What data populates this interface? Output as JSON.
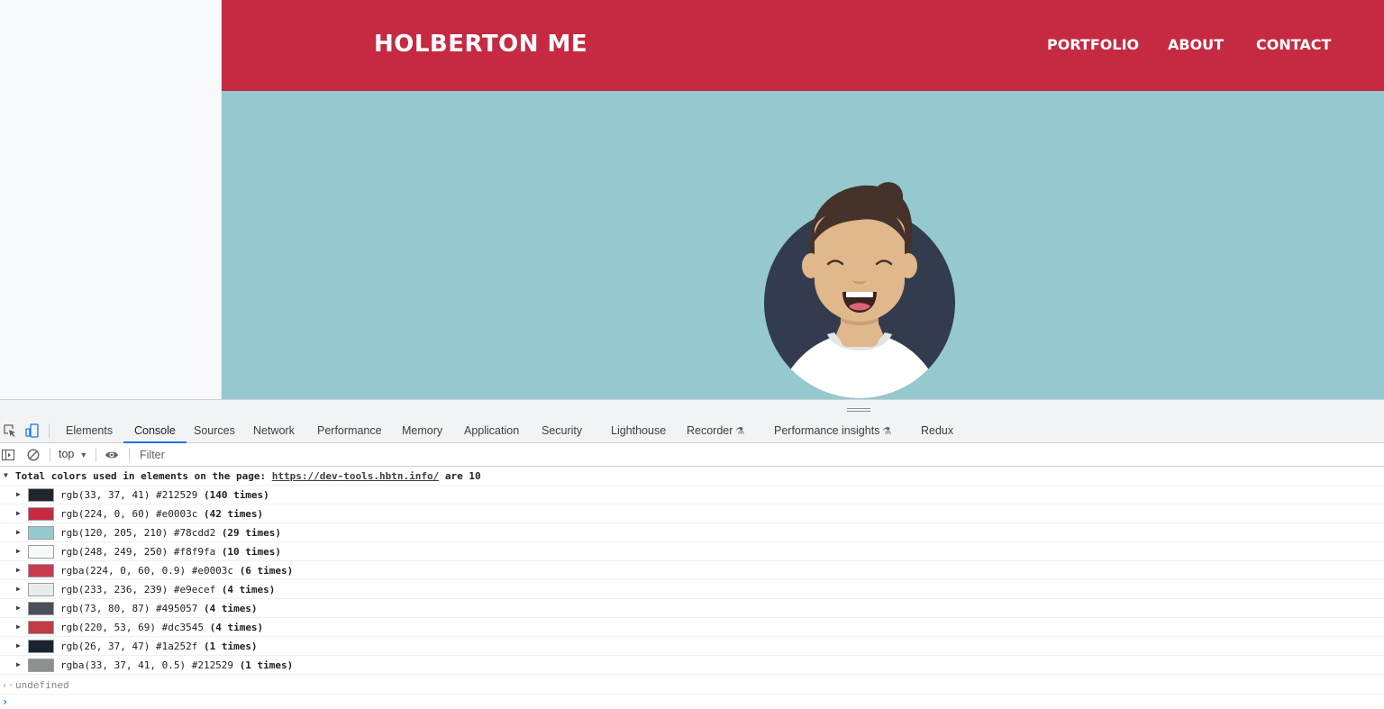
{
  "colors": {
    "site_header_bg": "#c52a42",
    "hero_bg": "#96c9cf",
    "avatar_circle": "#323c4e",
    "skin": "#e0b88c",
    "hair": "#45322b",
    "shirt": "#ffffff",
    "accent_blue": "#1a73e8"
  },
  "site": {
    "brand": "HOLBERTON ME",
    "nav": [
      "PORTFOLIO",
      "ABOUT",
      "CONTACT"
    ]
  },
  "devtools": {
    "tabs": [
      {
        "label": "Elements",
        "active": false
      },
      {
        "label": "Console",
        "active": true
      },
      {
        "label": "Sources",
        "active": false
      },
      {
        "label": "Network",
        "active": false
      },
      {
        "label": "Performance",
        "active": false
      },
      {
        "label": "Memory",
        "active": false
      },
      {
        "label": "Application",
        "active": false
      },
      {
        "label": "Security",
        "active": false
      },
      {
        "label": "Lighthouse",
        "active": false
      },
      {
        "label": "Recorder",
        "active": false,
        "experimental": true
      },
      {
        "label": "Performance insights",
        "active": false,
        "experimental": true
      },
      {
        "label": "Redux",
        "active": false
      }
    ],
    "icons": {
      "inspect": "inspect-element-icon",
      "device": "device-toolbar-icon",
      "sidebar": "console-sidebar-icon",
      "clear": "clear-console-icon",
      "eye": "live-expression-icon",
      "experimental": "flask-icon"
    },
    "console": {
      "context": "top",
      "filter_placeholder": "Filter",
      "group": {
        "prefix": "Total colors used in elements on the page: ",
        "url": "https://dev-tools.hbtn.info/",
        "suffix": " are 10"
      },
      "rows": [
        {
          "text": "rgb(33, 37, 41) #212529",
          "count": "(140 times)",
          "swatch": "#212529"
        },
        {
          "text": "rgb(224, 0, 60) #e0003c",
          "count": "(42 times)",
          "swatch": "#c52a42"
        },
        {
          "text": "rgb(120, 205, 210) #78cdd2",
          "count": "(29 times)",
          "swatch": "#96c9cf"
        },
        {
          "text": "rgb(248, 249, 250) #f8f9fa",
          "count": "(10 times)",
          "swatch": "#f8f9fa"
        },
        {
          "text": "rgba(224, 0, 60, 0.9) #e0003c",
          "count": "(6 times)",
          "swatch": "#c93b51"
        },
        {
          "text": "rgb(233, 236, 239) #e9ecef",
          "count": "(4 times)",
          "swatch": "#e9ecef"
        },
        {
          "text": "rgb(73, 80, 87) #495057",
          "count": "(4 times)",
          "swatch": "#495057"
        },
        {
          "text": "rgb(220, 53, 69) #dc3545",
          "count": "(4 times)",
          "swatch": "#c43a44"
        },
        {
          "text": "rgb(26, 37, 47) #1a252f",
          "count": "(1 times)",
          "swatch": "#1a252f"
        },
        {
          "text": "rgba(33, 37, 41, 0.5) #212529",
          "count": "(1 times)",
          "swatch": "#8e8f91"
        }
      ],
      "result": "undefined"
    }
  }
}
